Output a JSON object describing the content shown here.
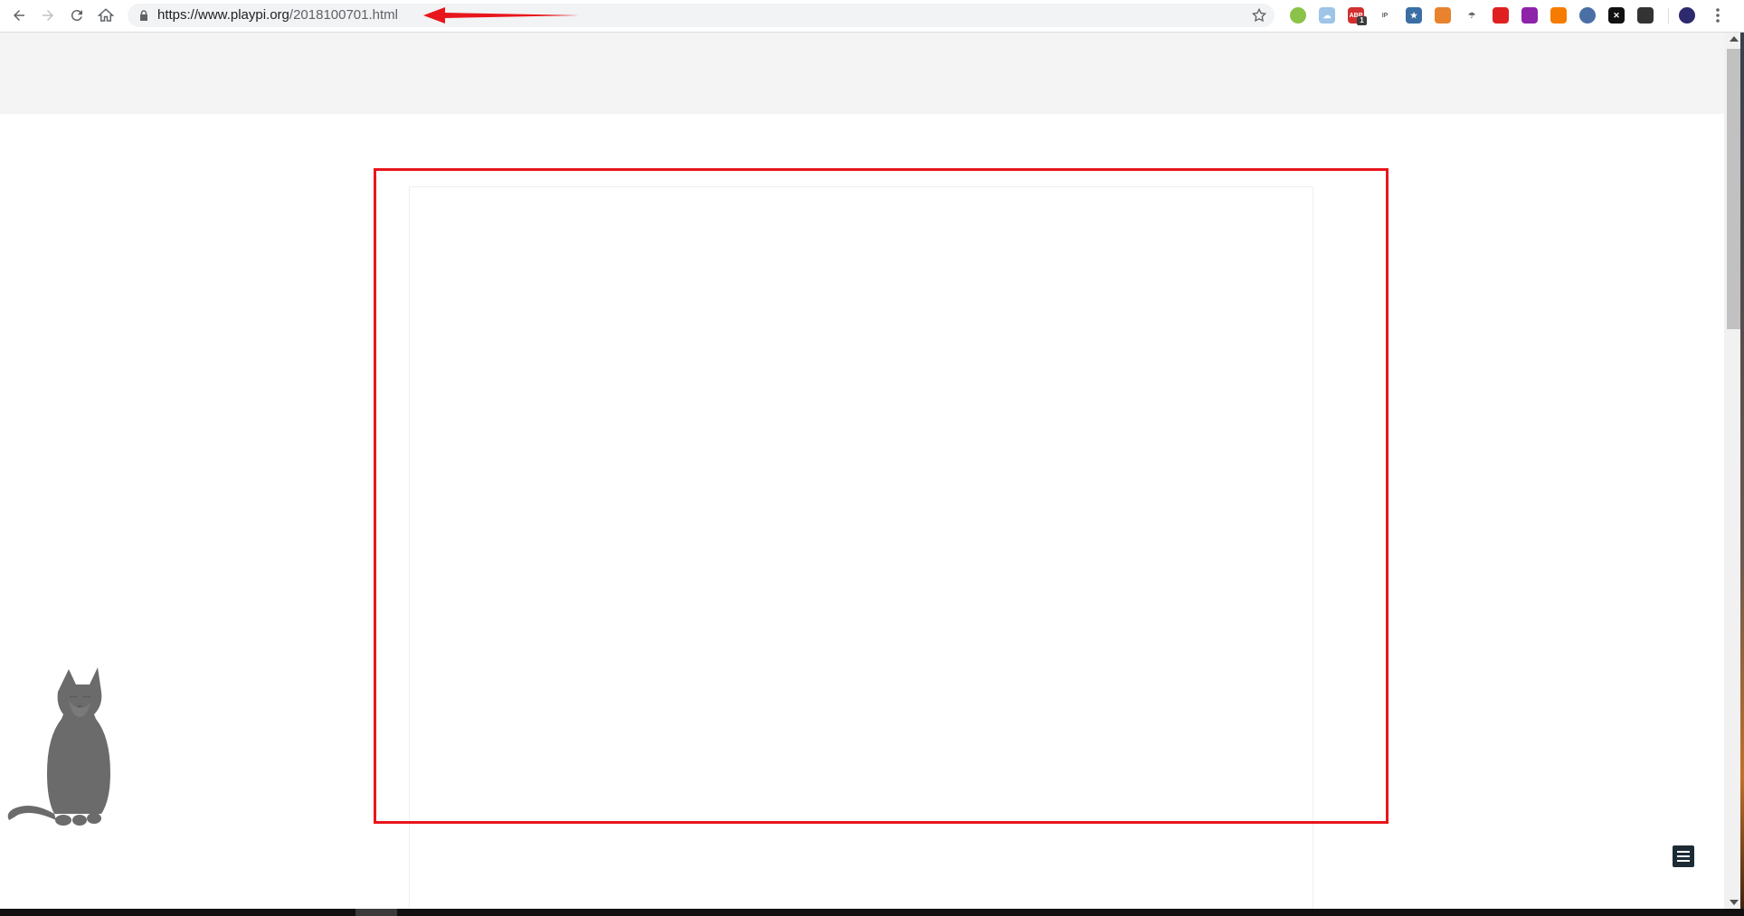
{
  "browser": {
    "url_host": "https://www.playpi.org",
    "url_path": "/2018100701.html",
    "extensions": [
      {
        "name": "green-circle-extension-icon",
        "glyph": "",
        "color": "#8bc34a"
      },
      {
        "name": "cloud-extension-icon",
        "glyph": "☁",
        "color": "#9ec5e8"
      },
      {
        "name": "adblock-extension-icon",
        "glyph": "ABP",
        "color": "#d32f2f",
        "badge": "1"
      },
      {
        "name": "ip-lookup-extension-icon",
        "glyph": "IP",
        "color": "#ffffff"
      },
      {
        "name": "bookmark-star-extension-icon",
        "glyph": "★",
        "color": "#3b6ea5"
      },
      {
        "name": "fox-extension-icon",
        "glyph": "",
        "color": "#e8822d"
      },
      {
        "name": "umbrella-extension-icon",
        "glyph": "☂",
        "color": "#ffffff"
      },
      {
        "name": "red-no-extension-icon",
        "glyph": "",
        "color": "#e02020"
      },
      {
        "name": "purple-extension-icon",
        "glyph": "",
        "color": "#8e24aa"
      },
      {
        "name": "weibo-extension-icon",
        "glyph": "",
        "color": "#f57c00"
      },
      {
        "name": "blue-circle-extension-icon",
        "glyph": "",
        "color": "#4a6fa5"
      },
      {
        "name": "x-extension-icon",
        "glyph": "✕",
        "color": "#111111"
      },
      {
        "name": "aperture-extension-icon",
        "glyph": "",
        "color": "#333333"
      },
      {
        "name": "profile-avatar-icon",
        "glyph": "",
        "color": "#2d2a6e"
      }
    ]
  },
  "colors": {
    "annotation_red": "#e8161c",
    "header_bg": "#f4f4f4",
    "float_menu_bg": "#1c2b36"
  }
}
